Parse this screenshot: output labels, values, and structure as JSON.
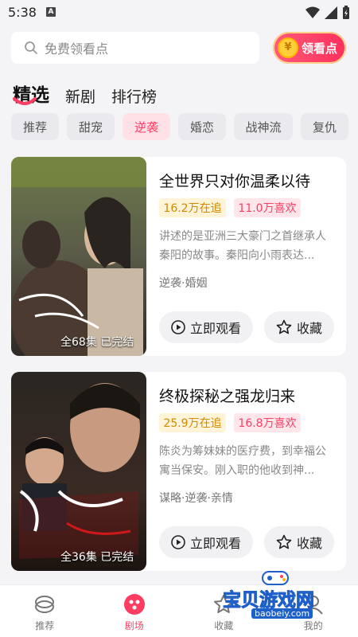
{
  "status": {
    "time": "5:38",
    "notification_letter": "A"
  },
  "search": {
    "placeholder": "免费领看点"
  },
  "coin_button": {
    "icon_glyph": "¥",
    "label": "领看点"
  },
  "main_tabs": [
    {
      "label": "精选",
      "active": true
    },
    {
      "label": "新剧",
      "active": false
    },
    {
      "label": "排行榜",
      "active": false
    }
  ],
  "chips": [
    {
      "label": "推荐",
      "active": false
    },
    {
      "label": "甜宠",
      "active": false
    },
    {
      "label": "逆袭",
      "active": true
    },
    {
      "label": "婚恋",
      "active": false
    },
    {
      "label": "战神流",
      "active": false
    },
    {
      "label": "复仇",
      "active": false
    }
  ],
  "cards": [
    {
      "title": "全世界只对你温柔以待",
      "follow": "16.2万在追",
      "like": "11.0万喜欢",
      "desc": "讲述的是亚洲三大豪门之首继承人秦阳的故事。秦阳向小雨表达...",
      "tags": "逆袭·婚姻",
      "poster_meta": "全68集 已完结",
      "watch_label": "立即观看",
      "fav_label": "收藏"
    },
    {
      "title": "终极探秘之强龙归来",
      "follow": "25.9万在追",
      "like": "16.8万喜欢",
      "desc": "陈炎为筹妹妹的医疗费，到幸福公寓当保安。刚入职的他收到神...",
      "tags": "谋略·逆袭·亲情",
      "poster_meta": "全36集 已完结",
      "watch_label": "立即观看",
      "fav_label": "收藏"
    }
  ],
  "bottom_nav": [
    {
      "label": "推荐",
      "icon": "recommend-icon",
      "active": false
    },
    {
      "label": "剧场",
      "icon": "theater-icon",
      "active": true
    },
    {
      "label": "收藏",
      "icon": "favorites-icon",
      "active": false
    },
    {
      "label": "我的",
      "icon": "profile-icon",
      "active": false
    }
  ],
  "watermark": {
    "text": "宝贝游戏网",
    "url": "baobeiy.com"
  },
  "colors": {
    "accent": "#ff3d63",
    "follow_badge": "#d38900",
    "background": "#f4f4f6"
  }
}
